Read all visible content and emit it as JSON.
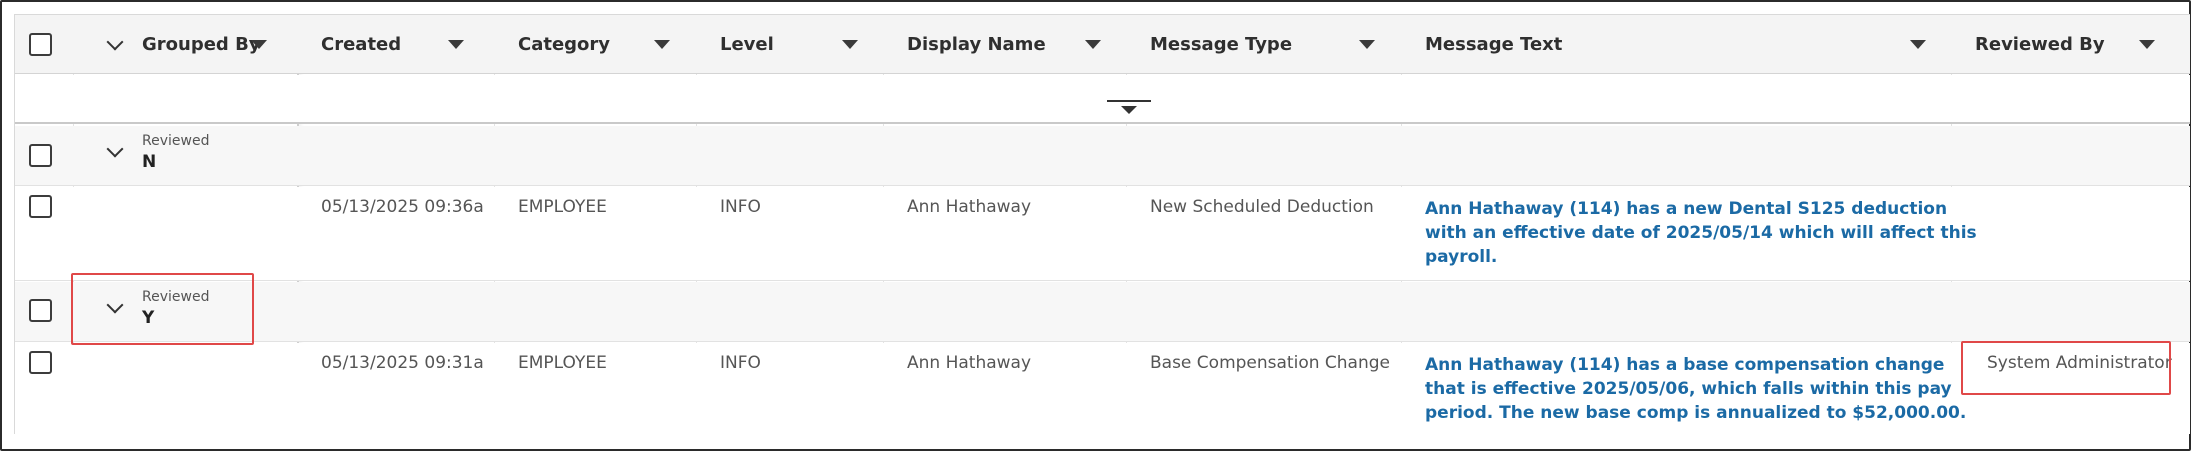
{
  "columns": {
    "grouped_by": "Grouped By",
    "created": "Created",
    "category": "Category",
    "level": "Level",
    "display_name": "Display Name",
    "message_type": "Message Type",
    "message_text": "Message Text",
    "reviewed_by": "Reviewed By"
  },
  "groups": [
    {
      "label": "Reviewed",
      "value": "N",
      "rows": [
        {
          "created": "05/13/2025 09:36a",
          "category": "EMPLOYEE",
          "level": "INFO",
          "display_name": "Ann Hathaway",
          "message_type": "New Scheduled Deduction",
          "message_lines": [
            "Ann Hathaway (114) has a new Dental S125 deduction",
            "with an effective date of 2025/05/14 which will affect this",
            "payroll."
          ],
          "reviewed_by": ""
        }
      ]
    },
    {
      "label": "Reviewed",
      "value": "Y",
      "rows": [
        {
          "created": "05/13/2025 09:31a",
          "category": "EMPLOYEE",
          "level": "INFO",
          "display_name": "Ann Hathaway",
          "message_type": "Base Compensation Change",
          "message_lines": [
            "Ann Hathaway (114) has a base compensation change",
            "that is effective 2025/05/06, which falls within this pay",
            "period. The new base comp is annualized to $52,000.00."
          ],
          "reviewed_by": "System Administrator"
        }
      ]
    }
  ],
  "icons": {
    "column_menu": "caret-down-icon",
    "group_toggle": "chevron-down-icon",
    "filter": "filter-icon",
    "select": "checkbox-icon"
  },
  "colors": {
    "message_link": "#1b6aa5",
    "highlight": "#e04848",
    "header_bg": "#f4f4f4",
    "group_bg": "#f7f7f7"
  }
}
